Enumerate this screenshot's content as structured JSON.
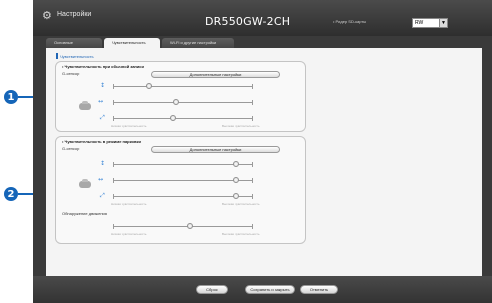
{
  "callouts": [
    "1",
    "2"
  ],
  "header": {
    "title": "Настройки",
    "model": "DR550GW-2CH",
    "sd_reader_label": "• Ридер SD-карты",
    "language": "RW"
  },
  "tabs": [
    {
      "label": "Основные"
    },
    {
      "label": "Чувствительность"
    },
    {
      "label": "Wi-Fi и другие настройки"
    }
  ],
  "breadcrumb": "Чувствительность",
  "normal_recording": {
    "title": "• Чувствительность при обычной записи",
    "sensor_label": "G-сенсор",
    "advanced_button": "Дополнительные настройки",
    "levels": [
      0.26,
      0.45,
      0.43
    ],
    "scale_low": "Низкая чувствительность",
    "scale_high": "Высокая чувствительность"
  },
  "parking_mode": {
    "title": "• Чувствительность в режиме парковки",
    "sensor_label": "G-сенсор",
    "advanced_button": "Дополнительные настройки",
    "levels": [
      0.88,
      0.88,
      0.88
    ],
    "scale_low": "Низкая чувствительность",
    "scale_high": "Высокая чувствительность",
    "motion_label": "Обнаружение движения",
    "motion_level": 0.55,
    "motion_scale_low": "Низкая чувствительность",
    "motion_scale_high": "Высокая чувствительность"
  },
  "footer": {
    "reset": "Сброс",
    "save_close": "Сохранить и закрыть",
    "cancel": "Отменить"
  },
  "icons": {
    "vertical_axis": "↕",
    "horizontal_axis": "↔",
    "diagonal_axis": "⤢",
    "gear": "⚙"
  }
}
